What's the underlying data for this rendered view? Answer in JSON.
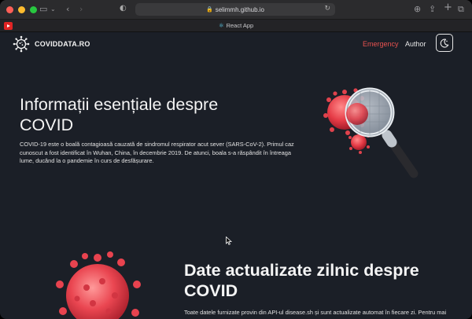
{
  "browser": {
    "url": "selimmh.github.io",
    "tab_title": "React App"
  },
  "site": {
    "brand": "COVIDDATA.RO",
    "nav": {
      "emergency": "Emergency",
      "author": "Author"
    },
    "accent_color": "#e8524f"
  },
  "hero": {
    "title": "Informații esențiale despre COVID",
    "text": "COVID-19 este o boală contagioasă cauzată de sindromul respirator acut sever (SARS-CoV-2). Primul caz cunoscut a fost identificat în Wuhan, China, în decembrie 2019. De atunci, boala s-a răspândit în întreaga lume, ducând la o pandemie în curs de desfășurare."
  },
  "section2": {
    "title": "Date actualizate zilnic despre COVID",
    "text": "Toate datele furnizate provin din API-ul disease.sh și sunt actualizate automat în fiecare zi. Pentru mai"
  }
}
